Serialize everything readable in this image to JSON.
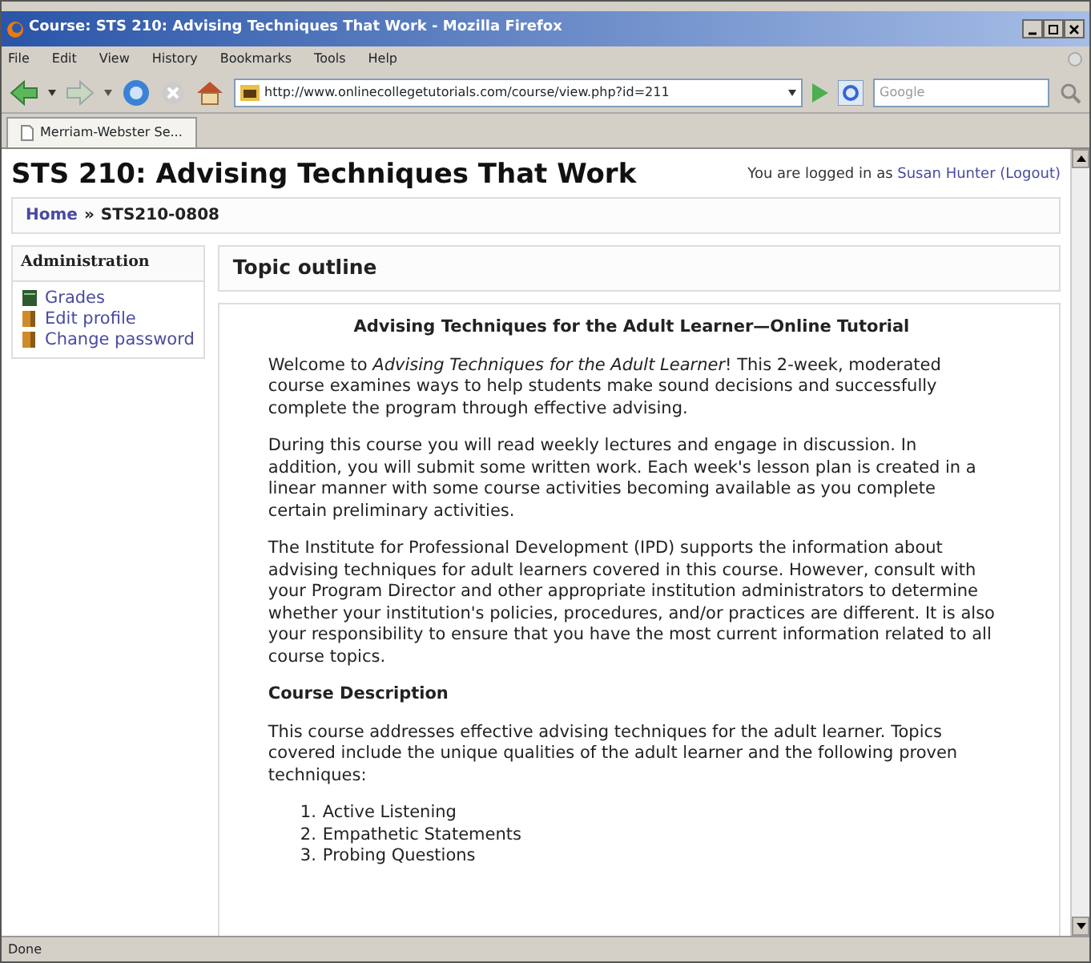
{
  "window": {
    "title": "Course: STS 210: Advising Techniques That Work - Mozilla Firefox"
  },
  "menu": [
    "File",
    "Edit",
    "View",
    "History",
    "Bookmarks",
    "Tools",
    "Help"
  ],
  "address": {
    "value": "http://www.onlinecollegetutorials.com/course/view.php?id=211"
  },
  "search": {
    "placeholder": "Google"
  },
  "tabs": [
    {
      "label": "Merriam-Webster Se...",
      "selected": true
    }
  ],
  "page": {
    "title": "STS 210: Advising Techniques That Work",
    "login": {
      "prefix": "You are logged in as",
      "user": "Susan Hunter",
      "logout": "(Logout)"
    },
    "breadcrumb": {
      "home": "Home",
      "separator": "»",
      "current": "STS210-0808"
    },
    "sidebar": {
      "title": "Administration",
      "items": [
        {
          "label": "Grades",
          "kind": "grades"
        },
        {
          "label": "Edit profile",
          "kind": "profile"
        },
        {
          "label": "Change password",
          "kind": "password"
        }
      ]
    },
    "topic": {
      "heading": "Topic outline",
      "content": [
        {
          "kind": "title",
          "text": "Advising Techniques for the Adult Learner—Online Tutorial"
        },
        {
          "kind": "paragraph",
          "text": "Welcome to *Advising Techniques for the Adult Learner*! This 2-week, moderated course examines ways to help students make sound decisions and successfully complete the program through effective advising."
        },
        {
          "kind": "paragraph",
          "text": "During this course you will read weekly lectures and engage in discussion. In addition, you will submit some written work. Each week's lesson plan is created in a linear manner with some course activities becoming available as you complete certain preliminary activities."
        },
        {
          "kind": "paragraph",
          "text": "The Institute for Professional Development (IPD) supports the information about advising techniques for adult learners covered in this course. However, consult with your Program Director and other appropriate institution administrators to determine whether your institution's policies, procedures, and/or practices are different. It is also your responsibility to ensure that you have the most current information related to all course topics."
        },
        {
          "kind": "subheading",
          "text": "Course Description"
        },
        {
          "kind": "paragraph",
          "text": "This course addresses effective advising techniques for the adult learner. Topics covered include the unique qualities of the adult learner and the following proven techniques:"
        },
        {
          "kind": "list",
          "items": [
            {
              "number": "1.",
              "text": "Active Listening"
            },
            {
              "number": "2.",
              "text": "Empathetic Statements"
            },
            {
              "number": "3.",
              "text": "Probing Questions"
            }
          ]
        }
      ]
    }
  },
  "status_bar": "Done"
}
